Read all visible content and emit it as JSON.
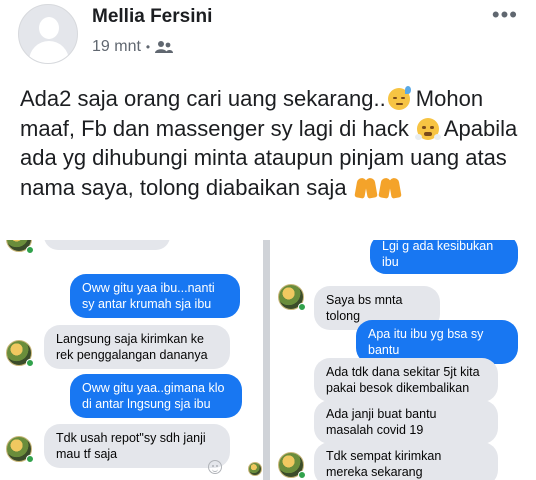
{
  "post": {
    "author": "Mellia Fersini",
    "time": "19 mnt",
    "separator": "•",
    "audience_icon": "friends-icon",
    "more_label": "•••",
    "text_segments": [
      "Ada2 saja orang cari uang sekarang..",
      " Mohon maaf, Fb dan massenger sy lagi di hack ",
      " Apabila ada yg dihubungi minta ataupun pinjam uang atas nama saya, tolong diabaikan saja "
    ],
    "emojis": [
      "sweat-face-emoji",
      "steam-nose-face-emoji",
      "folded-hands-emoji"
    ]
  },
  "chat_left": {
    "messages": [
      {
        "side": "out",
        "text": "Oww gitu yaa ibu...nanti sy antar krumah sja ibu"
      },
      {
        "side": "in",
        "text": "Langsung saja kirimkan ke rek penggalangan dananya"
      },
      {
        "side": "out",
        "text": "Oww gitu yaa..gimana klo di antar lngsung sja ibu"
      },
      {
        "side": "in",
        "text": "Tdk usah repot\"sy sdh janji mau tf saja"
      }
    ]
  },
  "chat_right": {
    "messages": [
      {
        "side": "out",
        "text": "Lgi g ada kesibukan ibu"
      },
      {
        "side": "in",
        "text": "Saya bs mnta tolong"
      },
      {
        "side": "out",
        "text": "Apa itu ibu yg bsa sy bantu"
      },
      {
        "side": "in",
        "text": "Ada tdk dana sekitar 5jt kita pakai besok dikembalikan"
      },
      {
        "side": "in",
        "text": "Ada janji buat bantu masalah covid 19"
      },
      {
        "side": "in",
        "text": "Tdk sempat kirimkan mereka sekarang"
      }
    ]
  },
  "colors": {
    "outgoing_bubble": "#1877f2",
    "incoming_bubble": "#e4e6eb",
    "online": "#31a24c"
  }
}
